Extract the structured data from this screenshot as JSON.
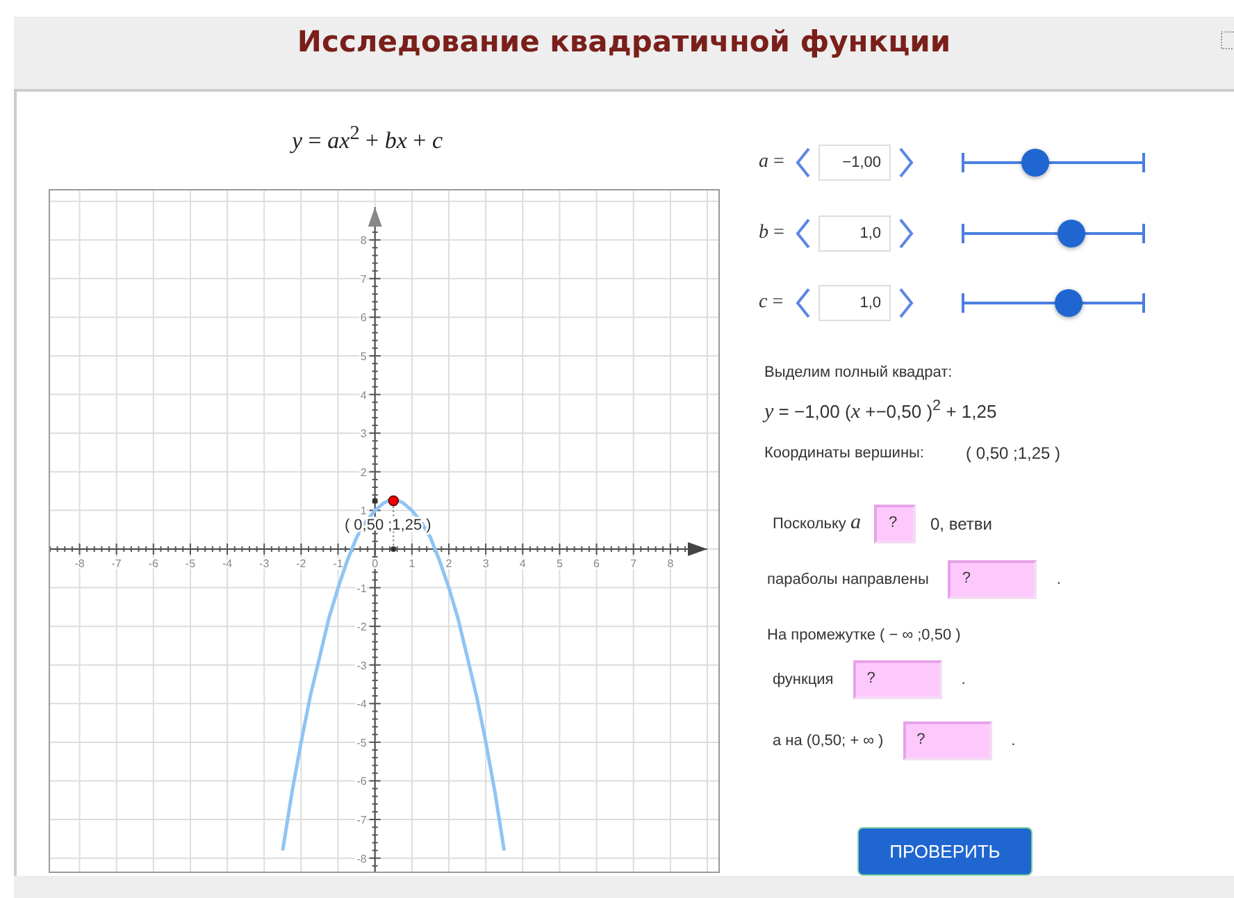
{
  "header": {
    "title": "Исследование квадратичной функции"
  },
  "formula": "*y* = *ax*$^{2}$ + *bx* + *c*",
  "graph": {
    "chart_data": {
      "type": "line",
      "grid": true,
      "xlim": [
        -8.8,
        9.0
      ],
      "ylim": [
        -8.42,
        8.85
      ],
      "xticks": [
        -8,
        -7,
        -6,
        -5,
        -4,
        -3,
        -2,
        -1,
        0,
        1,
        2,
        3,
        4,
        5,
        6,
        7,
        8
      ],
      "yticks": [
        -8,
        -7,
        -6,
        -5,
        -4,
        -3,
        -2,
        -1,
        1,
        2,
        3,
        4,
        5,
        6,
        7,
        8
      ],
      "x": [
        -2.5,
        -2.25,
        -2,
        -1.75,
        -1.5,
        -1.25,
        -1,
        -0.75,
        -0.5,
        -0.25,
        0,
        0.25,
        0.5,
        0.75,
        1,
        1.25,
        1.5,
        1.75,
        2,
        2.25,
        2.5,
        2.75,
        3,
        3.25,
        3.5
      ],
      "series": [
        {
          "color": "#90c4f4",
          "values": [
            -7.8,
            -6.3,
            -5,
            -3.8,
            -2.8,
            -1.8,
            -1,
            -0.3,
            0.3,
            0.7,
            1,
            1.2,
            1.3,
            1.2,
            1,
            0.7,
            0.3,
            -0.3,
            -1,
            -1.8,
            -2.8,
            -3.8,
            -5,
            -6.3,
            -7.8
          ]
        }
      ],
      "annotations": [
        {
          "x": 0.5,
          "y": 1.25,
          "text": "( 0,50 ;1,25 )"
        }
      ]
    }
  },
  "parameters": [
    {
      "label": "*a* =",
      "value": "−1,00",
      "level": 0.4
    },
    {
      "label": "*b* =",
      "value": "1,0",
      "level": 0.6
    },
    {
      "label": "*c* =",
      "value": "1,0",
      "level": 0.58
    }
  ],
  "completing_square": {
    "heading": "Выделим полный квадрат:",
    "equation": "*y* = −1,00 (*x* +−0,50 )$^{2}$ + 1,25"
  },
  "vertex": {
    "label": "Координаты вершины:",
    "value": "( 0,50 ;1,25 )"
  },
  "sentences": [
    {
      "kind": "short_field",
      "before": "Поскольку *a*",
      "answer": "?",
      "after": "0, ветви"
    },
    {
      "kind": "wide_field",
      "before": "параболы направлены",
      "answer": "?",
      "after": "."
    },
    {
      "kind": "text",
      "before": "На промежутке ( − ∞ ;0,50 )"
    },
    {
      "kind": "wide_field",
      "before": "функция",
      "answer": "?",
      "after": "."
    },
    {
      "kind": "wide_field",
      "before": "а на  (0,50; + ∞ )",
      "answer": "?",
      "after": "."
    }
  ],
  "check_button": "ПРОВЕРИТЬ"
}
